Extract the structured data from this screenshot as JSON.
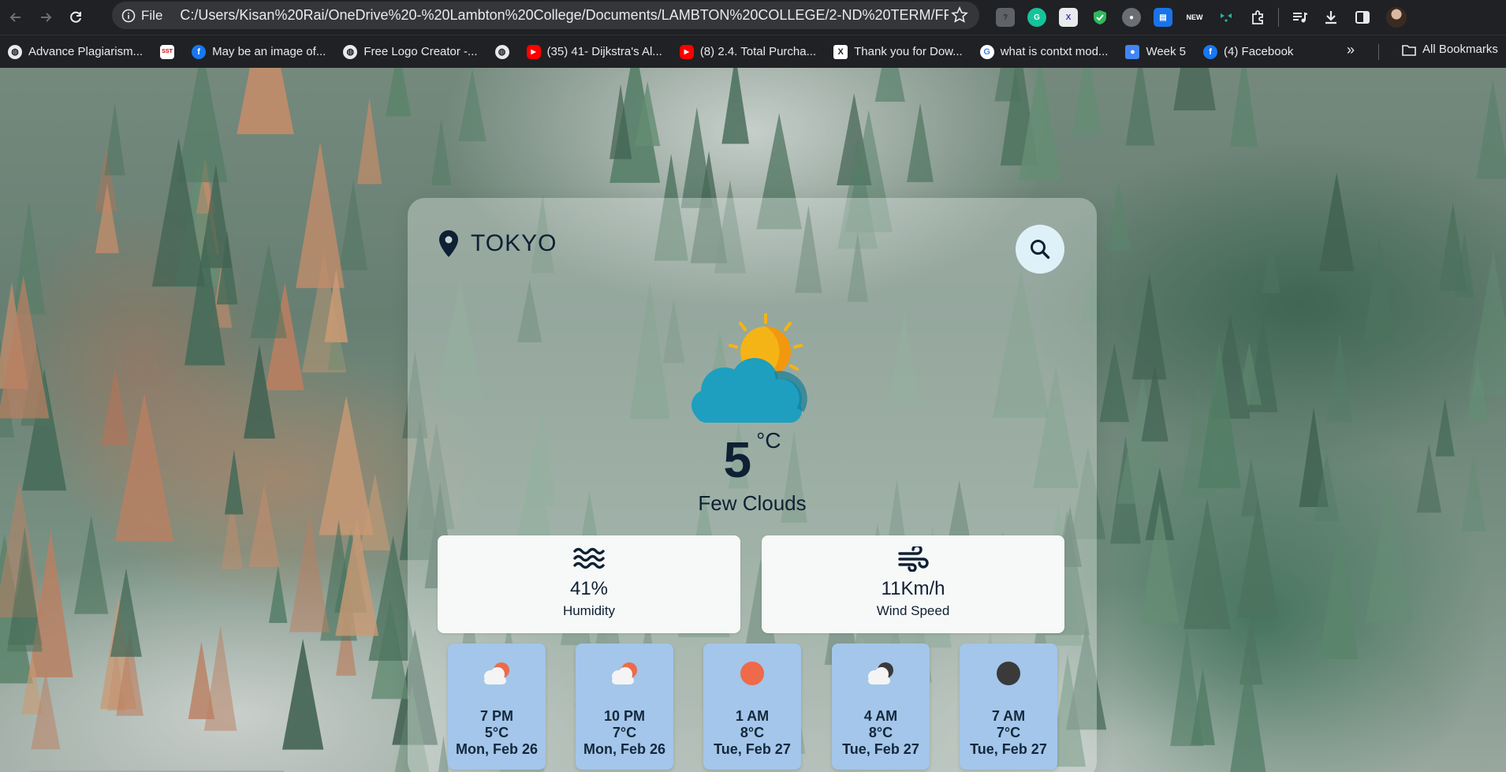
{
  "browser": {
    "site_chip": "File",
    "url": "C:/Users/Kisan%20Rai/OneDrive%20-%20Lambton%20College/Documents/LAMBTON%20COLLEGE/2-ND%20TERM/FRONT-...",
    "extensions": [
      "help-extension",
      "grammarly",
      "x-extension",
      "shield-extension",
      "record-extension",
      "docs-extension",
      "new-extension",
      "layers-extension",
      "puzzle-extensions"
    ],
    "new_badge": "NEW"
  },
  "bookmarks": {
    "items": [
      {
        "label": "Advance Plagiarism...",
        "icon": "globe-icon"
      },
      {
        "label": "",
        "icon": "sst-icon",
        "icon_text": "SST"
      },
      {
        "label": "May be an image of...",
        "icon": "facebook-icon"
      },
      {
        "label": "Free Logo Creator -...",
        "icon": "globe-icon"
      },
      {
        "label": "",
        "icon": "globe-icon"
      },
      {
        "label": "(35) 41- Dijkstra's Al...",
        "icon": "youtube-icon"
      },
      {
        "label": "(8) 2.4. Total Purcha...",
        "icon": "youtube-icon"
      },
      {
        "label": "Thank you for Dow...",
        "icon": "x-icon"
      },
      {
        "label": "what is contxt mod...",
        "icon": "google-icon"
      },
      {
        "label": "Week 5",
        "icon": "classroom-icon"
      },
      {
        "label": "(4) Facebook",
        "icon": "facebook-icon"
      }
    ],
    "all_bookmarks": "All Bookmarks"
  },
  "weather": {
    "city": "TOKYO",
    "temperature": "5",
    "unit": "°C",
    "description": "Few Clouds",
    "humidity": {
      "value": "41%",
      "label": "Humidity"
    },
    "wind": {
      "value": "11Km/h",
      "label": "Wind Speed"
    },
    "forecast": [
      {
        "time": "7 PM",
        "temp": "5°C",
        "date": "Mon, Feb 26",
        "icon": "cloud-sun-icon"
      },
      {
        "time": "10 PM",
        "temp": "7°C",
        "date": "Mon, Feb 26",
        "icon": "cloud-sun-icon"
      },
      {
        "time": "1 AM",
        "temp": "8°C",
        "date": "Tue, Feb 27",
        "icon": "sun-icon"
      },
      {
        "time": "4 AM",
        "temp": "8°C",
        "date": "Tue, Feb 27",
        "icon": "cloud-moon-icon"
      },
      {
        "time": "7 AM",
        "temp": "7°C",
        "date": "Tue, Feb 27",
        "icon": "moon-icon"
      }
    ]
  },
  "colors": {
    "card_tint": "#e8eeec",
    "forecast_card": "#a3c6ea",
    "text_dark": "#0e2033",
    "sun": "#f5b415",
    "cloud": "#1ea0c0",
    "forecast_sun": "#ee6a4a"
  }
}
